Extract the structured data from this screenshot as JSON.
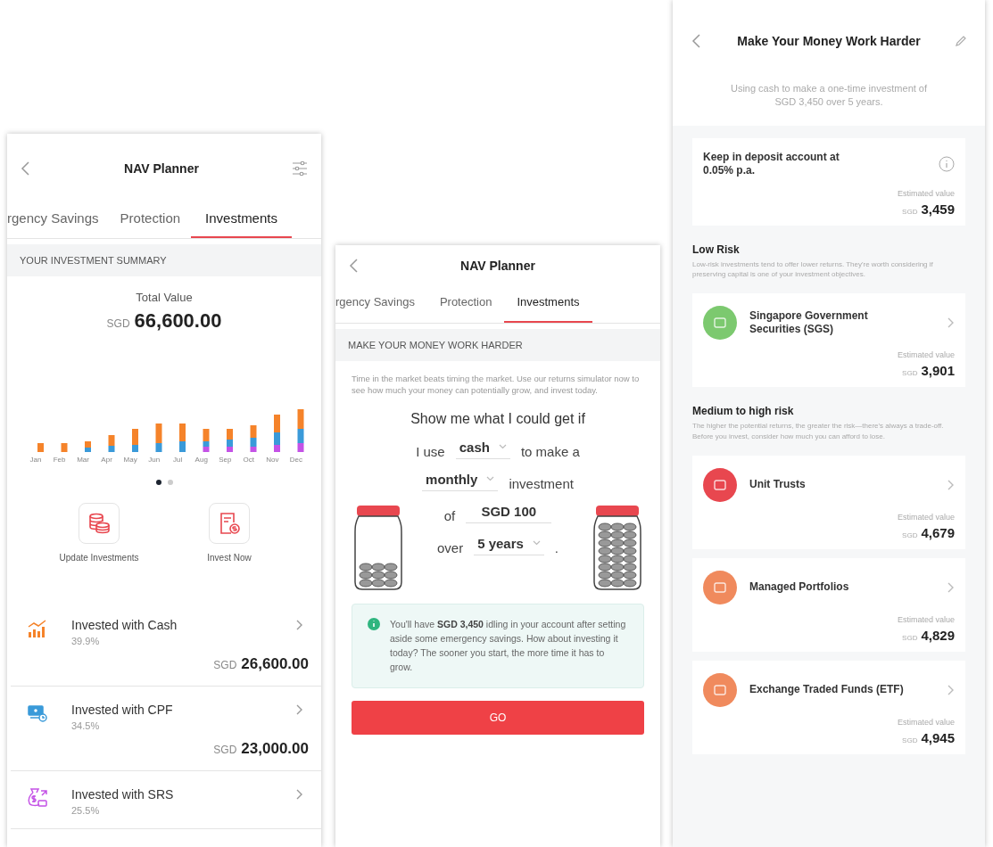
{
  "planner": {
    "title": "NAV Planner",
    "tabs": [
      {
        "label": "rgency Savings",
        "selected": false
      },
      {
        "label": "Protection",
        "selected": false
      },
      {
        "label": "Investments",
        "selected": true
      }
    ],
    "section_title": "YOUR INVESTMENT SUMMARY",
    "total_label": "Total Value",
    "total_currency": "SGD",
    "total_amount": "66,600.00",
    "months": [
      "Jan",
      "Feb",
      "Mar",
      "Apr",
      "May",
      "Jun",
      "Jul",
      "Aug",
      "Sep",
      "Oct",
      "Nov",
      "Dec"
    ],
    "pager_dots": [
      {
        "selected": true
      },
      {
        "selected": false
      }
    ],
    "actions": [
      {
        "kind": "coins",
        "label": "Update Investments"
      },
      {
        "kind": "invoice",
        "label": "Invest Now"
      }
    ],
    "holdings": [
      {
        "kind": "chart",
        "color": "#f5832a",
        "name": "Invested with Cash",
        "share": "39.9%",
        "currency": "SGD",
        "amount": "26,600.00"
      },
      {
        "kind": "cash",
        "color": "#3a9ad9",
        "name": "Invested with CPF",
        "share": "34.5%",
        "currency": "SGD",
        "amount": "23,000.00"
      },
      {
        "kind": "bag",
        "color": "#c452e6",
        "name": "Invested with SRS",
        "share": "25.5%"
      }
    ]
  },
  "simulator": {
    "title": "NAV Planner",
    "tabs": [
      {
        "label": "rgency Savings",
        "selected": false
      },
      {
        "label": "Protection",
        "selected": false
      },
      {
        "label": "Investments",
        "selected": true
      }
    ],
    "section_title": "MAKE YOUR MONEY WORK HARDER",
    "intro": "Time in the market beats timing the market. Use our returns simulator now to see how much your money can potentially grow, and invest today.",
    "heading": "Show me what I could get if",
    "lines": [
      [
        {
          "kind": "text",
          "text": "I use"
        },
        {
          "kind": "dropdown",
          "value": "cash"
        },
        {
          "kind": "text",
          "text": "to make a"
        }
      ],
      [
        {
          "kind": "dropdown",
          "value": "monthly"
        },
        {
          "kind": "text",
          "text": "investment"
        }
      ],
      [
        {
          "kind": "text",
          "text": "of"
        },
        {
          "kind": "input",
          "value": "SGD 100"
        }
      ],
      [
        {
          "kind": "text",
          "text": "over"
        },
        {
          "kind": "dropdown",
          "value": "5 years"
        },
        {
          "kind": "text",
          "text": "."
        }
      ]
    ],
    "tip": "You'll have **SGD 3,450** idling in your account after setting aside some emergency savings. How about investing it today? The sooner you start, the more time it has to grow.",
    "button": "GO"
  },
  "results": {
    "title": "Make Your Money Work Harder",
    "subtitle": "Using cash to make a one-time investment of SGD 3,450 over 5 years.",
    "deposit": {
      "name": "Keep in deposit account at 0.05% p.a.",
      "value_label": "Estimated value",
      "currency": "SGD",
      "amount": "3,459"
    },
    "groups": [
      {
        "title": "Low Risk",
        "description": "Low-risk investments tend to offer lower returns. They're worth considering if preserving capital is one of your investment objectives.",
        "options": [
          {
            "name": "Singapore Government Securities (SGS)",
            "color": "#7cc96f",
            "value_label": "Estimated value",
            "currency": "SGD",
            "amount": "3,901"
          }
        ]
      },
      {
        "title": "Medium to high risk",
        "description": "The higher the potential returns, the greater the risk—there's always a trade-off. Before you invest, consider how much you can afford to lose.",
        "options": [
          {
            "name": "Unit Trusts",
            "color": "#e8474f",
            "value_label": "Estimated value",
            "currency": "SGD",
            "amount": "4,679"
          },
          {
            "name": "Managed Portfolios",
            "color": "#f08a5d",
            "value_label": "Estimated value",
            "currency": "SGD",
            "amount": "4,829"
          },
          {
            "name": "Exchange Traded Funds (ETF)",
            "color": "#f08a5d",
            "value_label": "Estimated value",
            "currency": "SGD",
            "amount": "4,945"
          }
        ]
      }
    ]
  }
}
